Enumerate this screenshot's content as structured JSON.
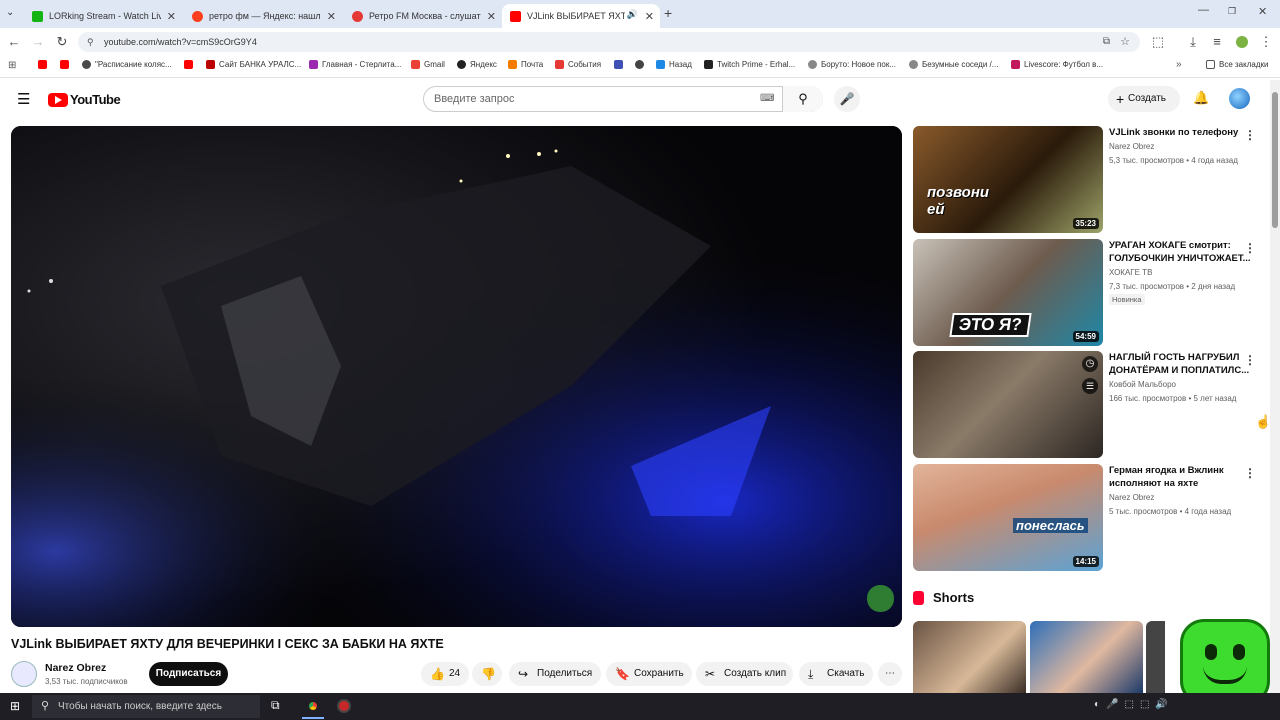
{
  "browser": {
    "tabs": [
      {
        "title": "LORking Stream - Watch Live o",
        "color": "#12b312",
        "active": false
      },
      {
        "title": "ретро фм — Яндекс: нашлось",
        "color": "#fc3f1d",
        "active": false
      },
      {
        "title": "Ретро FM Москва - слушать о",
        "color": "#e53935",
        "active": false
      },
      {
        "title": "VJLink ВЫБИРАЕТ ЯХТУ ДЛ",
        "color": "#ff0000",
        "active": true
      }
    ],
    "url": "youtube.com/watch?v=cmS9cOrG9Y4",
    "bookmarks": [
      {
        "label": "",
        "color": "#ff0000"
      },
      {
        "label": "",
        "color": "#ff0000"
      },
      {
        "label": "\"Расписание коляс...",
        "color": "#4a4a4a"
      },
      {
        "label": "",
        "color": "#ff0000"
      },
      {
        "label": "Сайт БАНКА УРАЛС...",
        "color": "#b00"
      },
      {
        "label": "Главная - Стерлита...",
        "color": "#9c27b0"
      },
      {
        "label": "Gmail",
        "color": "#ea4335"
      },
      {
        "label": "Яндекс",
        "color": "#222"
      },
      {
        "label": "Почта",
        "color": "#f57c00"
      },
      {
        "label": "События",
        "color": "#e53935"
      },
      {
        "label": "",
        "color": "#3f51b5"
      },
      {
        "label": "",
        "color": "#444"
      },
      {
        "label": "Назад",
        "color": "#1e88e5"
      },
      {
        "label": "Twitch Prime - Erhal...",
        "color": "#222"
      },
      {
        "label": "Боруто: Новое пок...",
        "color": "#888"
      },
      {
        "label": "Безумные соседи /...",
        "color": "#888"
      },
      {
        "label": "Livescore: Футбол в...",
        "color": "#c2185b"
      }
    ],
    "all_bookmarks": "Все закладки"
  },
  "youtube": {
    "logo": "YouTube",
    "search_placeholder": "Введите запрос",
    "create_label": "Создать",
    "video_title": "VJLink ВЫБИРАЕТ ЯХТУ ДЛЯ ВЕЧЕРИНКИ I СЕКС ЗА БАБКИ НА ЯХТЕ",
    "channel_name": "Narez Obrez",
    "subscribers": "3,53 тыс. подписчиков",
    "subscribe_label": "Подписаться",
    "likes": "24",
    "share_label": "Поделиться",
    "save_label": "Сохранить",
    "clip_label": "Создать клип",
    "download_label": "Скачать",
    "shorts_label": "Shorts",
    "recommendations": [
      {
        "title": "VJLink звонки по телефону",
        "channel": "Narez Obrez",
        "meta": "5,3 тыс. просмотров • 4 года назад",
        "duration": "35:23",
        "badge": "",
        "thumb_text": "позвони ей"
      },
      {
        "title": "УРАГАН ХОКАГЕ смотрит: ГОЛУБОЧКИН УНИЧТОЖАЕТ...",
        "channel": "ХОКАГЕ ТВ",
        "meta": "7,3 тыс. просмотров • 2 дня назад",
        "duration": "54:59",
        "badge": "Новинка",
        "thumb_text": "ЭТО Я?"
      },
      {
        "title": "НАГЛЫЙ ГОСТЬ НАГРУБИЛ ДОНАТЁРАМ И ПОПЛАТИЛС...",
        "channel": "Ковбой Мальборо",
        "meta": "166 тыс. просмотров • 5 лет назад",
        "duration": "",
        "badge": "",
        "thumb_text": ""
      },
      {
        "title": "Герман ягодка и Вжлинк исполняют на яхте",
        "channel": "Narez Obrez",
        "meta": "5 тыс. просмотров • 4 года назад",
        "duration": "14:15",
        "badge": "",
        "thumb_text": "понеслась"
      }
    ]
  },
  "taskbar": {
    "search_placeholder": "Чтобы начать поиск, введите здесь"
  }
}
